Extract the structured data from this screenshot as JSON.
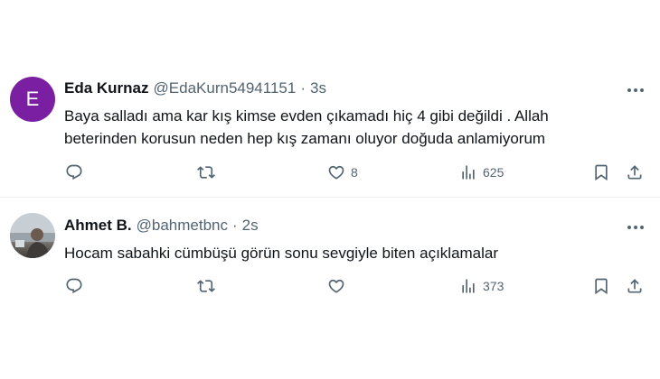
{
  "tweets": [
    {
      "avatar_letter": "E",
      "avatar_color": "#7b1fa2",
      "name": "Eda Kurnaz",
      "handle": "@EdaKurn54941151",
      "separator": "·",
      "time": "3s",
      "text_line1": "Baya salladı ama kar kış kimse evden çıkamadı hiç 4 gibi değildi . Allah",
      "text_line2": "beterinden korusun neden hep kış zamanı oluyor doğuda anlamiyorum",
      "replies": "",
      "retweets": "",
      "likes": "8",
      "views": "625"
    },
    {
      "name": "Ahmet B.",
      "handle": "@bahmetbnc",
      "separator": "·",
      "time": "2s",
      "text_line1": "Hocam sabahki cümbüşü görün sonu sevgiyle biten açıklamalar",
      "replies": "",
      "retweets": "",
      "likes": "",
      "views": "373"
    }
  ],
  "icons": {
    "more": "more-horizontal-icon",
    "reply": "reply-icon",
    "retweet": "retweet-icon",
    "like": "heart-icon",
    "views": "views-icon",
    "bookmark": "bookmark-icon",
    "share": "share-icon"
  },
  "colors": {
    "text": "#0f1419",
    "secondary": "#536471",
    "divider": "#eff3f4"
  }
}
